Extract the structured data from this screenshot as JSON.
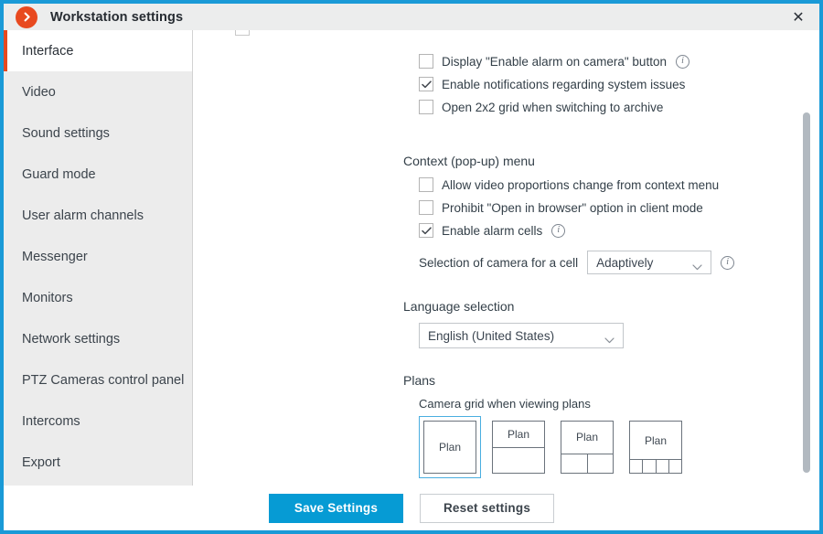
{
  "titlebar": {
    "title": "Workstation settings",
    "app_icon": "chevron-right-circle-icon",
    "close_label": "✕",
    "accent_color": "#1a9ad7",
    "icon_color": "#e8491f"
  },
  "sidebar": {
    "items": [
      {
        "label": "Interface",
        "active": true
      },
      {
        "label": "Video",
        "active": false
      },
      {
        "label": "Sound settings",
        "active": false
      },
      {
        "label": "Guard mode",
        "active": false
      },
      {
        "label": "User alarm channels",
        "active": false
      },
      {
        "label": "Messenger",
        "active": false
      },
      {
        "label": "Monitors",
        "active": false
      },
      {
        "label": "Network settings",
        "active": false
      },
      {
        "label": "PTZ Cameras control panel",
        "active": false
      },
      {
        "label": "Intercoms",
        "active": false
      },
      {
        "label": "Export",
        "active": false
      }
    ],
    "active_indicator_color": "#e8491f"
  },
  "content": {
    "top_checkboxes": [
      {
        "label": "Display \"Enable alarm on camera\" button",
        "checked": false,
        "info": true
      },
      {
        "label": "Enable notifications regarding system issues",
        "checked": true,
        "info": false
      },
      {
        "label": "Open 2x2 grid when switching to archive",
        "checked": false,
        "info": false
      }
    ],
    "context_menu": {
      "title": "Context (pop-up) menu",
      "checkboxes": [
        {
          "label": "Allow video proportions change from context menu",
          "checked": false,
          "info": false
        },
        {
          "label": "Prohibit \"Open in browser\" option in client mode",
          "checked": false,
          "info": false
        },
        {
          "label": "Enable alarm cells",
          "checked": true,
          "info": true
        }
      ],
      "camera_selection": {
        "label": "Selection of camera for a cell",
        "value": "Adaptively",
        "options": [
          "Adaptively"
        ],
        "info": true
      }
    },
    "language": {
      "title": "Language selection",
      "value": "English (United States)",
      "options": [
        "English (United States)"
      ]
    },
    "plans": {
      "title": "Plans",
      "subtitle": "Camera grid when viewing plans",
      "plan_cell_label": "Plan",
      "selected_index": 0,
      "layouts": [
        {
          "name": "single-cell",
          "bottom_cells": 0,
          "selected": true
        },
        {
          "name": "plan-plus-1",
          "bottom_cells": 1,
          "selected": false
        },
        {
          "name": "plan-plus-2",
          "bottom_cells": 2,
          "selected": false
        },
        {
          "name": "plan-plus-4",
          "bottom_cells": 4,
          "selected": false
        }
      ],
      "selection_color": "#4aaee0"
    },
    "scrollbar": {
      "thumb_color": "#b2b9c0"
    }
  },
  "footer": {
    "save_label": "Save Settings",
    "reset_label": "Reset settings",
    "primary_color": "#069bd4"
  }
}
